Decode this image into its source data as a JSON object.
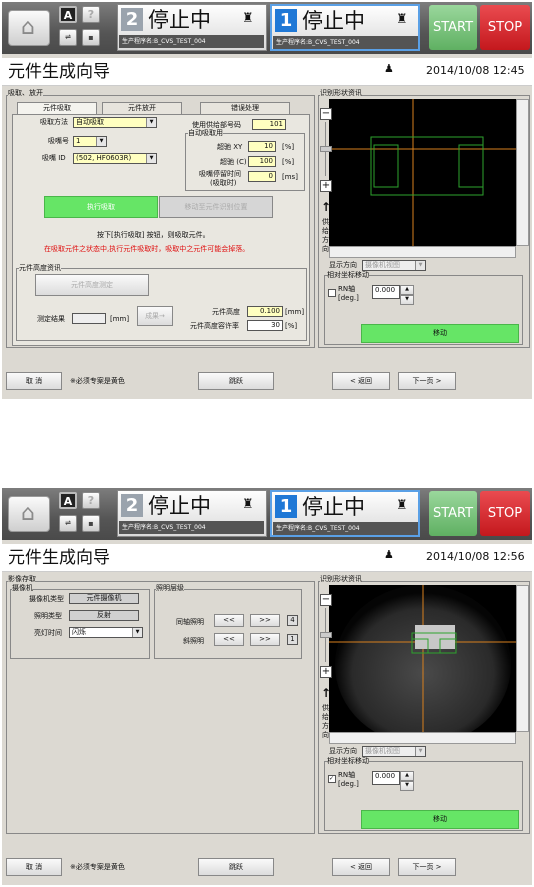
{
  "toolbar": {
    "home_icon": "home-icon",
    "btn_a": "A",
    "btn_q": "?",
    "lane1": {
      "num": "2",
      "status": "停止中",
      "program": "生产程序名:B_CVS_TEST_004"
    },
    "lane2": {
      "num": "1",
      "status": "停止中",
      "program": "生产程序名:B_CVS_TEST_004"
    },
    "start": "START",
    "stop": "STOP",
    "accent_start": "#5fb062",
    "accent_stop": "#c4181d",
    "selected_lane_color": "#1f78d6"
  },
  "screens": [
    {
      "title": "元件生成向导",
      "datetime": "2014/10/08 12:45",
      "group_label": "吸取、放开",
      "tabs": [
        "元件吸取",
        "元件放开",
        "错误处理"
      ],
      "pick_method_label": "吸取方法",
      "pick_method": "自动吸取",
      "nozzle_no_label": "吸嘴号",
      "nozzle_no": "1",
      "nozzle_id_label": "吸嘴 ID",
      "nozzle_id": "(502, HF0603R)",
      "feeder_label": "使用供给部号码",
      "feeder": "101",
      "auto_pick_label": "自动吸取用",
      "xy_label": "超驰 XY",
      "xy": "10",
      "xy_unit": "[%]",
      "c_label": "超驰 (C)",
      "c": "100",
      "c_unit": "[%]",
      "dwell_label": "吸嘴停留时间",
      "dwell_sub": "(吸取时)",
      "dwell": "0",
      "dwell_unit": "[ms]",
      "exec_pick": "执行吸取",
      "move_pos": "移动至元件识别位置",
      "hint1": "按下[执行吸取] 按钮，则吸取元件。",
      "hint2": "在吸取元件之状态中,执行元件吸取时，吸取中之元件可能会掉落。",
      "height_group": "元件高度资讯",
      "height_measure": "元件高度测定",
      "result_label": "测定结果",
      "result_unit": "[mm]",
      "result_btn": "成果→",
      "height_label": "元件高度",
      "height": "0.100",
      "height_unit": "[mm]",
      "tol_label": "元件高度容许率",
      "tol": "30",
      "tol_unit": "[%]",
      "view_group": "识别形状资讯",
      "dir_text": "供给方向",
      "dir_label": "显示方向",
      "view_select": "摄像机视图",
      "rel_label": "相对坐标移动",
      "rn_label": "RN轴",
      "rn_unit": "[deg.]",
      "rn_value": "0.000",
      "rn_checked": false,
      "move": "移动",
      "cancel": "取 消",
      "note": "※必须专案是黄色",
      "skip": "跳跃",
      "back": "< 返回",
      "next": "下一页 >"
    },
    {
      "title": "元件生成向导",
      "datetime": "2014/10/08 12:56",
      "group_label": "影像存取",
      "camera_group": "摄像机",
      "cam_type_label": "摄像机类型",
      "cam_type": "元件摄像机",
      "light_type_label": "照明类型",
      "light_type": "反射",
      "exposure_label": "亮灯时间",
      "exposure": "闪烁",
      "light_level_group": "照明层级",
      "coaxial_label": "同轴照明",
      "coaxial_value": "4",
      "oblique_label": "斜照明",
      "oblique_value": "1",
      "dec_btn": "<<",
      "inc_btn": ">>",
      "view_group": "识别形状资讯",
      "dir_text": "供给方向",
      "dir_label": "显示方向",
      "view_select": "摄像机视图",
      "rel_label": "相对坐标移动",
      "rn_label": "RN轴",
      "rn_unit": "[deg.]",
      "rn_value": "0.000",
      "rn_checked": true,
      "move": "移动",
      "cancel": "取 消",
      "note": "※必须专案是黄色",
      "skip": "跳跃",
      "back": "< 返回",
      "next": "下一页 >"
    }
  ]
}
